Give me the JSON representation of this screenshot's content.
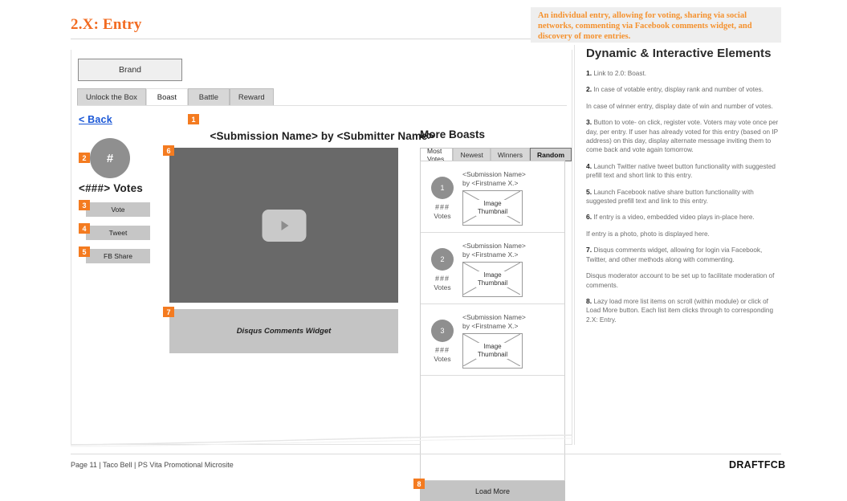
{
  "header": {
    "title": "2.X: Entry",
    "callout": "An individual entry, allowing for voting, sharing via social networks, commenting via Facebook comments widget, and discovery of more entries."
  },
  "wireframe": {
    "brand_label": "Brand",
    "tabs": [
      {
        "label": "Unlock the Box",
        "active": false
      },
      {
        "label": "Boast",
        "active": true
      },
      {
        "label": "Battle",
        "active": false
      },
      {
        "label": "Reward",
        "active": false
      }
    ],
    "back_link": "< Back",
    "rank_placeholder": "#",
    "votes_label": "<###> Votes",
    "buttons": [
      {
        "label": "Vote",
        "badge": "3"
      },
      {
        "label": "Tweet",
        "badge": "4"
      },
      {
        "label": "FB Share",
        "badge": "5"
      }
    ],
    "submission_heading": "<Submission Name> by <Submitter Name>",
    "video_badge": "6",
    "disqus_label": "Disqus Comments Widget",
    "disqus_badge": "7",
    "back_badge": "1",
    "rank_badge": "2"
  },
  "more_boasts": {
    "title": "More Boasts",
    "filters": [
      {
        "label": "Most Votes",
        "state": "active"
      },
      {
        "label": "Newest",
        "state": "default"
      },
      {
        "label": "Winners",
        "state": "default"
      },
      {
        "label": "Random",
        "state": "strong"
      }
    ],
    "items": [
      {
        "rank": "1",
        "votes_count": "###",
        "votes_label": "Votes",
        "name": "<Submission Name>",
        "by": "by <Firstname X.>",
        "thumb_line1": "Image",
        "thumb_line2": "Thumbnail"
      },
      {
        "rank": "2",
        "votes_count": "###",
        "votes_label": "Votes",
        "name": "<Submission Name>",
        "by": "by <Firstname X.>",
        "thumb_line1": "Image",
        "thumb_line2": "Thumbnail"
      },
      {
        "rank": "3",
        "votes_count": "###",
        "votes_label": "Votes",
        "name": "<Submission Name>",
        "by": "by <Firstname X.>",
        "thumb_line1": "Image",
        "thumb_line2": "Thumbnail"
      }
    ],
    "load_more": "Load More",
    "load_more_badge": "8"
  },
  "annotations": {
    "heading": "Dynamic & Interactive Elements",
    "items": [
      {
        "num": "1.",
        "text": "Link to 2.0: Boast."
      },
      {
        "num": "2.",
        "text": "In case of votable entry, display rank and number of votes."
      },
      {
        "num": "",
        "text": "In case of winner entry, display date of win and number of votes."
      },
      {
        "num": "3.",
        "text": "Button to vote- on click, register vote. Voters may vote once per day, per entry. If user has already voted for this entry (based on IP address) on this day, display alternate message inviting them to come back and vote again tomorrow."
      },
      {
        "num": "4.",
        "text": "Launch Twitter native tweet button functionality with suggested prefill text and short link to this entry."
      },
      {
        "num": "5.",
        "text": "Launch Facebook native share button functionality with suggested prefill text and link to this entry."
      },
      {
        "num": "6.",
        "text": "If entry is a video, embedded video plays in-place here."
      },
      {
        "num": "",
        "text": "If entry is a photo, photo is displayed here."
      },
      {
        "num": "7.",
        "text": "Disqus comments widget, allowing for login via Facebook, Twitter, and other methods along with commenting."
      },
      {
        "num": "",
        "text": "Disqus moderator account to be set up to facilitate moderation of comments."
      },
      {
        "num": "8.",
        "text": "Lazy load more list items on scroll (within module) or click of Load More button. Each list item clicks through to corresponding 2.X: Entry."
      }
    ]
  },
  "footer": {
    "left": "Page 11 | Taco Bell | PS Vita Promotional Microsite",
    "logo": "DRAFTFCB"
  },
  "colors": {
    "accent_orange": "#F47B20",
    "title_orange": "#F26B21",
    "link_blue": "#1a57d6"
  }
}
